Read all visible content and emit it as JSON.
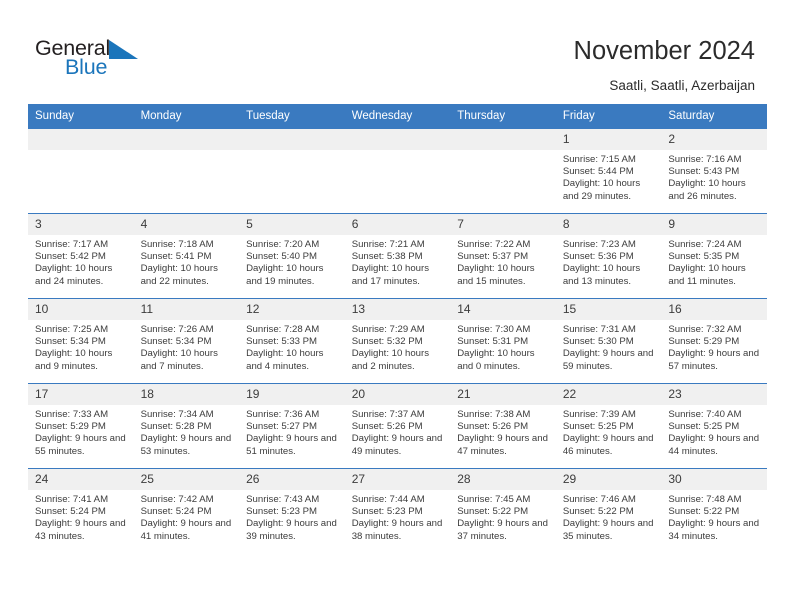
{
  "brand": {
    "name_part1": "General",
    "name_part2": "Blue"
  },
  "header": {
    "title": "November 2024",
    "subtitle": "Saatli, Saatli, Azerbaijan"
  },
  "colors": {
    "header_blue": "#3a7ac0",
    "brand_blue": "#1b75bb",
    "daynum_band": "#f0f0f0",
    "text": "#3c3c3c"
  },
  "weekday_headers": [
    "Sunday",
    "Monday",
    "Tuesday",
    "Wednesday",
    "Thursday",
    "Friday",
    "Saturday"
  ],
  "weeks": [
    [
      {
        "day": "",
        "empty": true
      },
      {
        "day": "",
        "empty": true
      },
      {
        "day": "",
        "empty": true
      },
      {
        "day": "",
        "empty": true
      },
      {
        "day": "",
        "empty": true
      },
      {
        "day": "1",
        "sunrise": "Sunrise: 7:15 AM",
        "sunset": "Sunset: 5:44 PM",
        "daylight": "Daylight: 10 hours and 29 minutes."
      },
      {
        "day": "2",
        "sunrise": "Sunrise: 7:16 AM",
        "sunset": "Sunset: 5:43 PM",
        "daylight": "Daylight: 10 hours and 26 minutes."
      }
    ],
    [
      {
        "day": "3",
        "sunrise": "Sunrise: 7:17 AM",
        "sunset": "Sunset: 5:42 PM",
        "daylight": "Daylight: 10 hours and 24 minutes."
      },
      {
        "day": "4",
        "sunrise": "Sunrise: 7:18 AM",
        "sunset": "Sunset: 5:41 PM",
        "daylight": "Daylight: 10 hours and 22 minutes."
      },
      {
        "day": "5",
        "sunrise": "Sunrise: 7:20 AM",
        "sunset": "Sunset: 5:40 PM",
        "daylight": "Daylight: 10 hours and 19 minutes."
      },
      {
        "day": "6",
        "sunrise": "Sunrise: 7:21 AM",
        "sunset": "Sunset: 5:38 PM",
        "daylight": "Daylight: 10 hours and 17 minutes."
      },
      {
        "day": "7",
        "sunrise": "Sunrise: 7:22 AM",
        "sunset": "Sunset: 5:37 PM",
        "daylight": "Daylight: 10 hours and 15 minutes."
      },
      {
        "day": "8",
        "sunrise": "Sunrise: 7:23 AM",
        "sunset": "Sunset: 5:36 PM",
        "daylight": "Daylight: 10 hours and 13 minutes."
      },
      {
        "day": "9",
        "sunrise": "Sunrise: 7:24 AM",
        "sunset": "Sunset: 5:35 PM",
        "daylight": "Daylight: 10 hours and 11 minutes."
      }
    ],
    [
      {
        "day": "10",
        "sunrise": "Sunrise: 7:25 AM",
        "sunset": "Sunset: 5:34 PM",
        "daylight": "Daylight: 10 hours and 9 minutes."
      },
      {
        "day": "11",
        "sunrise": "Sunrise: 7:26 AM",
        "sunset": "Sunset: 5:34 PM",
        "daylight": "Daylight: 10 hours and 7 minutes."
      },
      {
        "day": "12",
        "sunrise": "Sunrise: 7:28 AM",
        "sunset": "Sunset: 5:33 PM",
        "daylight": "Daylight: 10 hours and 4 minutes."
      },
      {
        "day": "13",
        "sunrise": "Sunrise: 7:29 AM",
        "sunset": "Sunset: 5:32 PM",
        "daylight": "Daylight: 10 hours and 2 minutes."
      },
      {
        "day": "14",
        "sunrise": "Sunrise: 7:30 AM",
        "sunset": "Sunset: 5:31 PM",
        "daylight": "Daylight: 10 hours and 0 minutes."
      },
      {
        "day": "15",
        "sunrise": "Sunrise: 7:31 AM",
        "sunset": "Sunset: 5:30 PM",
        "daylight": "Daylight: 9 hours and 59 minutes."
      },
      {
        "day": "16",
        "sunrise": "Sunrise: 7:32 AM",
        "sunset": "Sunset: 5:29 PM",
        "daylight": "Daylight: 9 hours and 57 minutes."
      }
    ],
    [
      {
        "day": "17",
        "sunrise": "Sunrise: 7:33 AM",
        "sunset": "Sunset: 5:29 PM",
        "daylight": "Daylight: 9 hours and 55 minutes."
      },
      {
        "day": "18",
        "sunrise": "Sunrise: 7:34 AM",
        "sunset": "Sunset: 5:28 PM",
        "daylight": "Daylight: 9 hours and 53 minutes."
      },
      {
        "day": "19",
        "sunrise": "Sunrise: 7:36 AM",
        "sunset": "Sunset: 5:27 PM",
        "daylight": "Daylight: 9 hours and 51 minutes."
      },
      {
        "day": "20",
        "sunrise": "Sunrise: 7:37 AM",
        "sunset": "Sunset: 5:26 PM",
        "daylight": "Daylight: 9 hours and 49 minutes."
      },
      {
        "day": "21",
        "sunrise": "Sunrise: 7:38 AM",
        "sunset": "Sunset: 5:26 PM",
        "daylight": "Daylight: 9 hours and 47 minutes."
      },
      {
        "day": "22",
        "sunrise": "Sunrise: 7:39 AM",
        "sunset": "Sunset: 5:25 PM",
        "daylight": "Daylight: 9 hours and 46 minutes."
      },
      {
        "day": "23",
        "sunrise": "Sunrise: 7:40 AM",
        "sunset": "Sunset: 5:25 PM",
        "daylight": "Daylight: 9 hours and 44 minutes."
      }
    ],
    [
      {
        "day": "24",
        "sunrise": "Sunrise: 7:41 AM",
        "sunset": "Sunset: 5:24 PM",
        "daylight": "Daylight: 9 hours and 43 minutes."
      },
      {
        "day": "25",
        "sunrise": "Sunrise: 7:42 AM",
        "sunset": "Sunset: 5:24 PM",
        "daylight": "Daylight: 9 hours and 41 minutes."
      },
      {
        "day": "26",
        "sunrise": "Sunrise: 7:43 AM",
        "sunset": "Sunset: 5:23 PM",
        "daylight": "Daylight: 9 hours and 39 minutes."
      },
      {
        "day": "27",
        "sunrise": "Sunrise: 7:44 AM",
        "sunset": "Sunset: 5:23 PM",
        "daylight": "Daylight: 9 hours and 38 minutes."
      },
      {
        "day": "28",
        "sunrise": "Sunrise: 7:45 AM",
        "sunset": "Sunset: 5:22 PM",
        "daylight": "Daylight: 9 hours and 37 minutes."
      },
      {
        "day": "29",
        "sunrise": "Sunrise: 7:46 AM",
        "sunset": "Sunset: 5:22 PM",
        "daylight": "Daylight: 9 hours and 35 minutes."
      },
      {
        "day": "30",
        "sunrise": "Sunrise: 7:48 AM",
        "sunset": "Sunset: 5:22 PM",
        "daylight": "Daylight: 9 hours and 34 minutes."
      }
    ]
  ]
}
